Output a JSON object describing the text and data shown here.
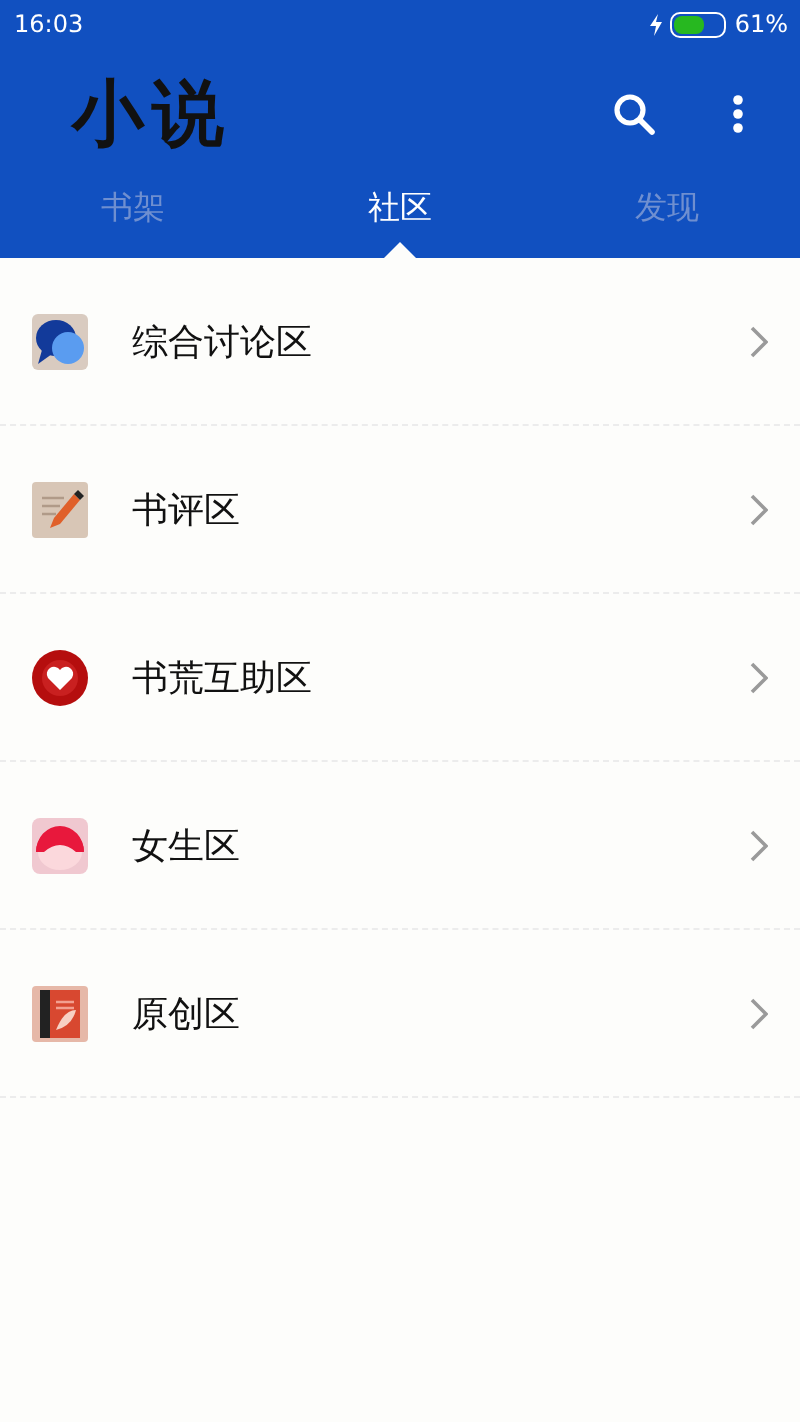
{
  "status_bar": {
    "time": "16:03",
    "battery_text": "61%",
    "charging": true
  },
  "app_bar": {
    "title": "小说"
  },
  "tabs": [
    {
      "label": "书架",
      "selected": false
    },
    {
      "label": "社区",
      "selected": true
    },
    {
      "label": "发现",
      "selected": false
    }
  ],
  "forums": [
    {
      "label": "综合讨论区",
      "kind": "chat"
    },
    {
      "label": "书评区",
      "kind": "review"
    },
    {
      "label": "书荒互助区",
      "kind": "heart"
    },
    {
      "label": "女生区",
      "kind": "girl"
    },
    {
      "label": "原创区",
      "kind": "book"
    }
  ]
}
